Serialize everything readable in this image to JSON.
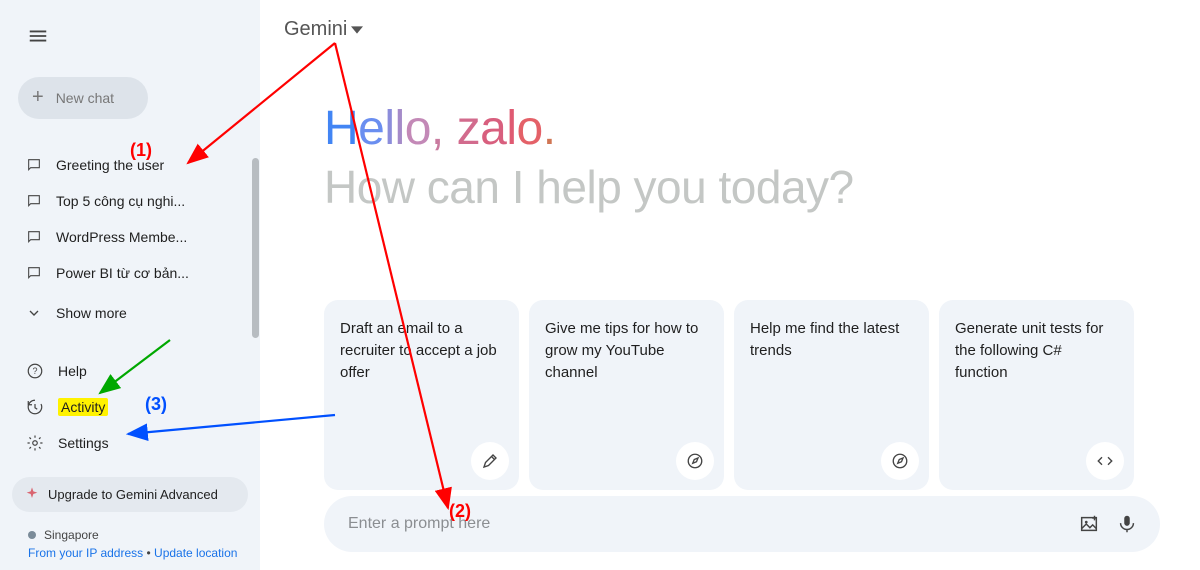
{
  "brand": "Gemini",
  "sidebar": {
    "new_chat": "New chat",
    "recent": [
      "Greeting the user",
      "Top 5 công cụ nghi...",
      "WordPress Membe...",
      "Power BI từ cơ bản..."
    ],
    "show_more": "Show more",
    "help": "Help",
    "activity": "Activity",
    "settings": "Settings",
    "upgrade": "Upgrade to Gemini Advanced",
    "location_country": "Singapore",
    "location_line1": "From your IP address",
    "location_dot": " • ",
    "location_update": "Update location"
  },
  "hero": {
    "hello_prefix": "Hello, ",
    "hello_name": "zalo",
    "hello_suffix": ".",
    "subhead": "How can I help you today?"
  },
  "cards": [
    "Draft an email to a recruiter to accept a job offer",
    "Give me tips for how to grow my YouTube channel",
    "Help me find the latest trends",
    "Generate unit tests for the following C# function"
  ],
  "prompt": {
    "placeholder": "Enter a prompt here"
  },
  "annotations": {
    "a1": "(1)",
    "a2": "(2)",
    "a3": "(3)"
  }
}
